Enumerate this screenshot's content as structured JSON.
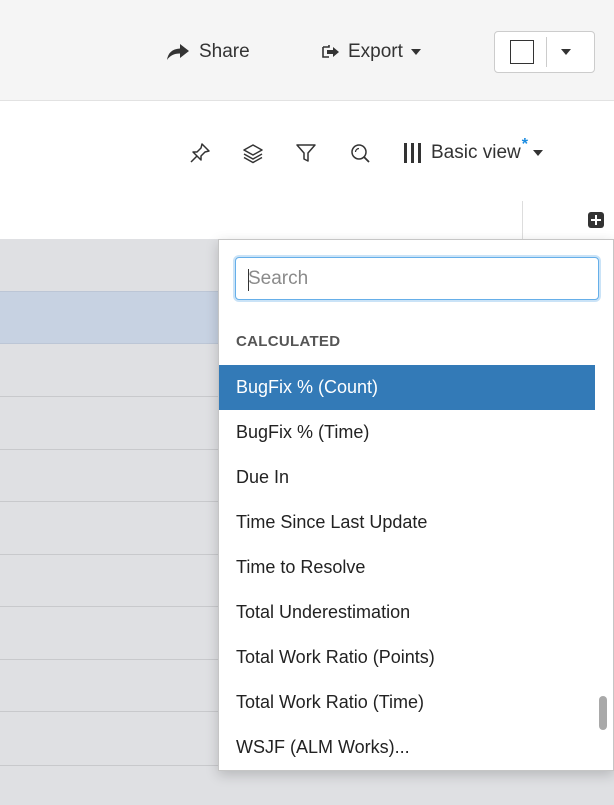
{
  "toolbar": {
    "share_label": "Share",
    "export_label": "Export"
  },
  "view": {
    "name": "Basic view",
    "modified_marker": "*"
  },
  "icons": [
    "share-arrow-icon",
    "export-icon",
    "pin-icon",
    "layers-icon",
    "filter-icon",
    "search-icon",
    "columns-icon",
    "add-column-icon"
  ],
  "dropdown": {
    "search_placeholder": "Search",
    "group_header": "CALCULATED",
    "items": [
      "BugFix % (Count)",
      "BugFix % (Time)",
      "Due In",
      "Time Since Last Update",
      "Time to Resolve",
      "Total Underestimation",
      "Total Work Ratio (Points)",
      "Total Work Ratio (Time)",
      "WSJF (ALM Works)..."
    ],
    "active_index": 0
  },
  "colors": {
    "accent": "#337ab7",
    "focus_ring": "#66afe9",
    "modified_star": "#1a8be0",
    "selected_row": "#c7d2e2"
  }
}
